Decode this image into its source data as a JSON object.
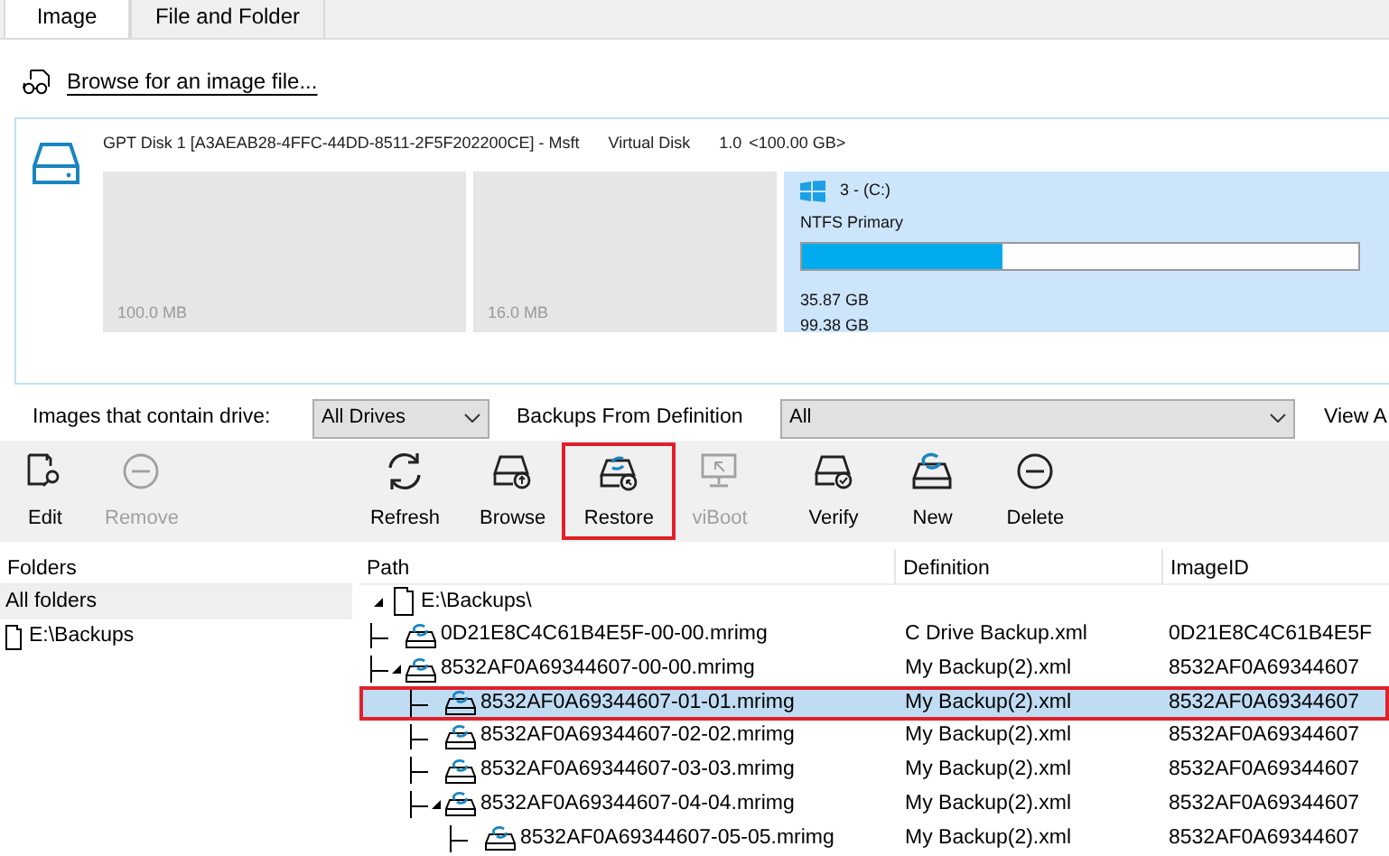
{
  "tabs": [
    {
      "label": "Image",
      "selected": true
    },
    {
      "label": "File and Folder",
      "selected": false
    }
  ],
  "browse_link": "Browse for an image file...",
  "disk": {
    "title": "GPT Disk 1 [A3AEAB28-4FFC-44DD-8511-2F5F202200CE] - Msft",
    "model": "Virtual Disk",
    "version": "1.0",
    "size": "<100.00 GB>",
    "partitions": [
      {
        "kind": "hidden",
        "size": "100.0 MB",
        "selected": false
      },
      {
        "kind": "hidden",
        "size": "16.0 MB",
        "selected": false
      },
      {
        "kind": "volume",
        "label": "3 - (C:)",
        "type": "NTFS Primary",
        "level": 0.36,
        "used": "35.87 GB",
        "total": "99.38 GB",
        "selected": true
      }
    ]
  },
  "filters": {
    "drive_label": "Images that contain drive:",
    "drive_value": "All Drives",
    "definition_label": "Backups From Definition",
    "definition_value": "All",
    "view_label": "View A"
  },
  "toolbar": [
    {
      "kind": "edit",
      "label": "Edit",
      "disabled": false,
      "outlined": false
    },
    {
      "kind": "remove",
      "label": "Remove",
      "disabled": true,
      "outlined": false
    },
    {
      "kind": "refresh",
      "label": "Refresh",
      "disabled": false,
      "outlined": false
    },
    {
      "kind": "browse",
      "label": "Browse",
      "disabled": false,
      "outlined": false
    },
    {
      "kind": "restore",
      "label": "Restore",
      "disabled": false,
      "outlined": true
    },
    {
      "kind": "viboot",
      "label": "viBoot",
      "disabled": true,
      "outlined": false
    },
    {
      "kind": "verify",
      "label": "Verify",
      "disabled": false,
      "outlined": false
    },
    {
      "kind": "new",
      "label": "New",
      "disabled": false,
      "outlined": false
    },
    {
      "kind": "delete",
      "label": "Delete",
      "disabled": false,
      "outlined": false
    }
  ],
  "folders": {
    "header": "Folders",
    "items": [
      {
        "label": "All folders",
        "selected": true,
        "kind": "all"
      },
      {
        "label": "E:\\Backups",
        "selected": false,
        "kind": "folder"
      }
    ]
  },
  "table": {
    "columns": [
      "Path",
      "Definition",
      "ImageID"
    ],
    "rows": [
      {
        "kind": "folder",
        "path": "E:\\Backups\\",
        "expanded": true,
        "selected": false,
        "outlined": false,
        "children": [
          {
            "kind": "image",
            "path": "0D21E8C4C61B4E5F-00-00.mrimg",
            "definition": "C Drive Backup.xml",
            "image_id": "0D21E8C4C61B4E5F",
            "selected": false,
            "outlined": false
          },
          {
            "kind": "image",
            "path": "8532AF0A69344607-00-00.mrimg",
            "definition": "My Backup(2).xml",
            "image_id": "8532AF0A69344607",
            "expanded": true,
            "selected": false,
            "outlined": false,
            "children": [
              {
                "kind": "image",
                "path": "8532AF0A69344607-01-01.mrimg",
                "definition": "My Backup(2).xml",
                "image_id": "8532AF0A69344607",
                "selected": true,
                "outlined": true
              },
              {
                "kind": "image",
                "path": "8532AF0A69344607-02-02.mrimg",
                "definition": "My Backup(2).xml",
                "image_id": "8532AF0A69344607",
                "selected": false,
                "outlined": false
              },
              {
                "kind": "image",
                "path": "8532AF0A69344607-03-03.mrimg",
                "definition": "My Backup(2).xml",
                "image_id": "8532AF0A69344607",
                "selected": false,
                "outlined": false
              },
              {
                "kind": "image",
                "path": "8532AF0A69344607-04-04.mrimg",
                "definition": "My Backup(2).xml",
                "image_id": "8532AF0A69344607",
                "expanded": true,
                "selected": false,
                "outlined": false,
                "children": [
                  {
                    "kind": "image",
                    "path": "8532AF0A69344607-05-05.mrimg",
                    "definition": "My Backup(2).xml",
                    "image_id": "8532AF0A69344607",
                    "selected": false,
                    "outlined": false
                  }
                ]
              }
            ]
          }
        ]
      }
    ]
  }
}
